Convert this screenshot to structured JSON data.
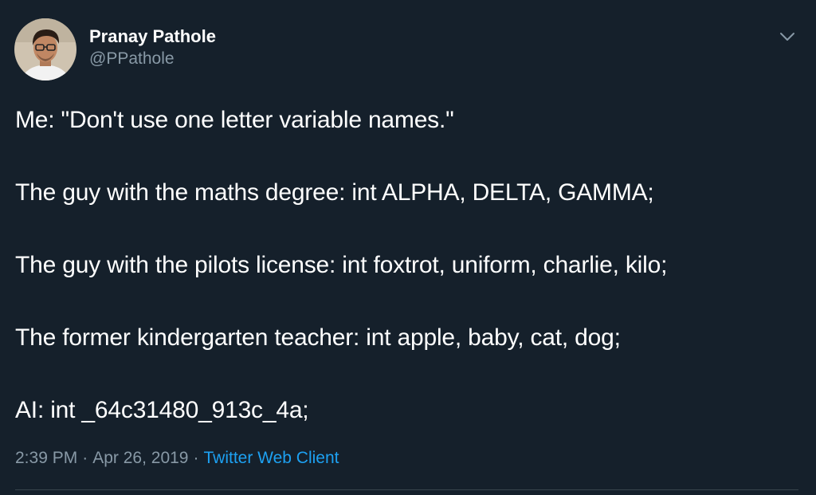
{
  "author": {
    "display_name": "Pranay Pathole",
    "handle": "@PPathole",
    "avatar_icon": "profile-photo"
  },
  "tweet": {
    "lines": [
      "Me: \"Don't use one letter variable names.\"",
      "The guy with the maths degree: int ALPHA, DELTA, GAMMA;",
      "The guy with the pilots license: int foxtrot, uniform, charlie, kilo;",
      "The former kindergarten teacher: int apple, baby, cat, dog;",
      "AI: int _64c31480_913c_4a;"
    ]
  },
  "meta": {
    "time": "2:39 PM",
    "separator": "·",
    "date": "Apr 26, 2019",
    "client": "Twitter Web Client"
  },
  "icons": {
    "more": "chevron-down-icon"
  },
  "colors": {
    "background": "#15202b",
    "text": "#ffffff",
    "secondary": "#8899a6",
    "link": "#1da1f2",
    "divider": "#38444d"
  }
}
